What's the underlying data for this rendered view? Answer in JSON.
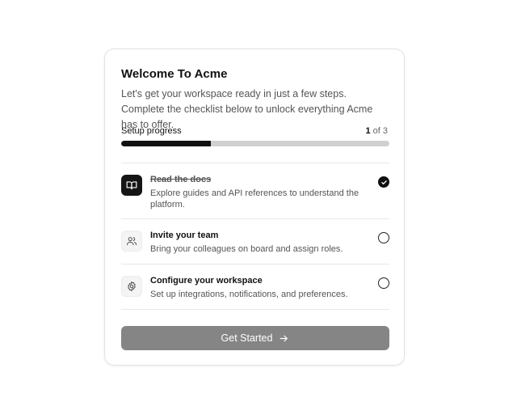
{
  "card": {
    "title": "Welcome To Acme",
    "subtitle": "Let's get your workspace ready in just a few steps. Complete the checklist below to unlock everything Acme has to offer."
  },
  "progress": {
    "label": "Setup progress",
    "completed": "1",
    "total_text": "of 3",
    "fraction": 0.333
  },
  "tasks": [
    {
      "title": "Read the docs",
      "description": "Explore guides and API references to understand the platform.",
      "done": true,
      "icon": "book-icon"
    },
    {
      "title": "Invite your team",
      "description": "Bring your colleagues on board and assign roles.",
      "done": false,
      "icon": "users-icon"
    },
    {
      "title": "Configure your workspace",
      "description": "Set up integrations, notifications, and preferences.",
      "done": false,
      "icon": "gear-icon"
    }
  ],
  "cta": {
    "label": "Get Started",
    "icon": "arrow-right-icon"
  },
  "colors": {
    "accent": "#111111",
    "track": "#d0d0d0",
    "button": "#858585"
  }
}
